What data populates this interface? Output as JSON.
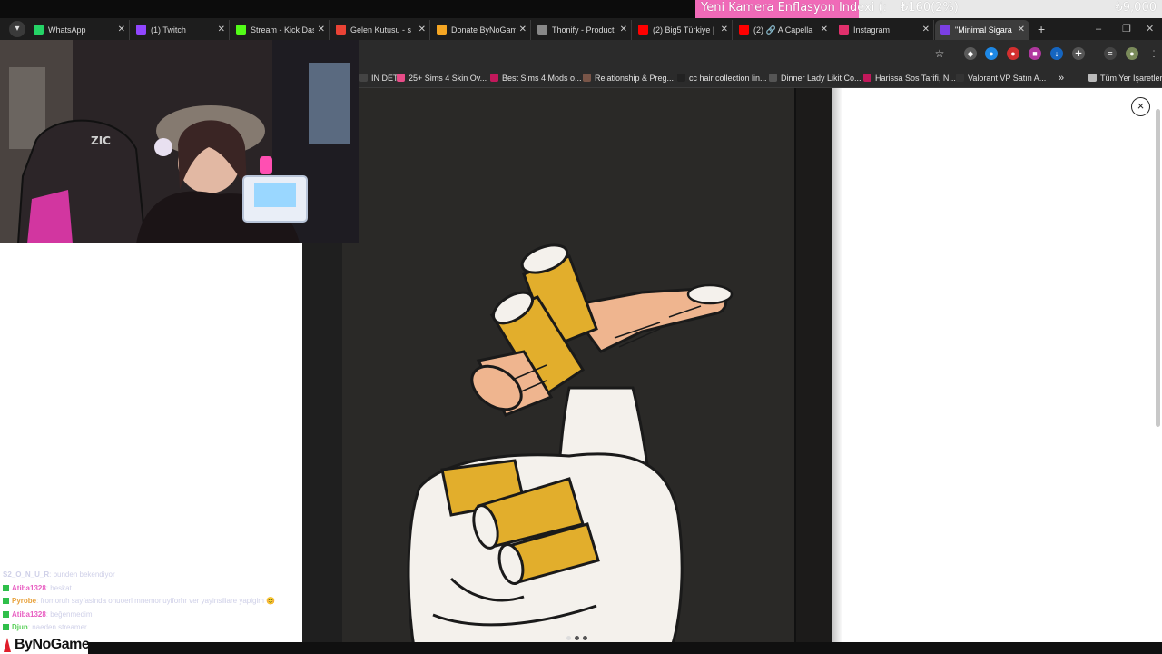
{
  "donation_goal": {
    "title": "Yeni Kamera Enflasyon Indexi (:",
    "current": "₺160(2%)",
    "target": "₺9,000",
    "progress_fraction": 0.35,
    "fill_color": "#f06ab8"
  },
  "tabs": [
    {
      "label": "WhatsApp",
      "icon": "whatsapp-icon",
      "color": "#25d366",
      "active": false
    },
    {
      "label": "(1) Twitch",
      "icon": "twitch-icon",
      "color": "#9146ff",
      "active": false
    },
    {
      "label": "Stream - Kick Das",
      "icon": "kick-icon",
      "color": "#53fc18",
      "active": false
    },
    {
      "label": "Gelen Kutusu - s",
      "icon": "gmail-icon",
      "color": "#ea4335",
      "active": false
    },
    {
      "label": "Donate ByNoGam",
      "icon": "donate-icon",
      "color": "#f5a623",
      "active": false
    },
    {
      "label": "Thonify - Product",
      "icon": "globe-icon",
      "color": "#888888",
      "active": false
    },
    {
      "label": "(2) Big5 Türkiye |",
      "icon": "youtube-icon",
      "color": "#ff0000",
      "active": false
    },
    {
      "label": "(2) 🔗 A Capella",
      "icon": "youtube-icon",
      "color": "#ff0000",
      "active": false
    },
    {
      "label": "Instagram",
      "icon": "instagram-icon",
      "color": "#e1306c",
      "active": false
    },
    {
      "label": "\"Minimal Sigara (",
      "icon": "site-icon",
      "color": "#7b3fe4",
      "active": true
    }
  ],
  "bookmarks": [
    {
      "label": "IN DET...",
      "color": "#444444"
    },
    {
      "label": "25+ Sims 4 Skin Ov...",
      "color": "#e84c88"
    },
    {
      "label": "Best Sims 4 Mods o...",
      "color": "#c2185b"
    },
    {
      "label": "Relationship & Preg...",
      "color": "#795548"
    },
    {
      "label": "cc hair collection lin...",
      "color": "#222222"
    },
    {
      "label": "Dinner Lady Likit Co...",
      "color": "#555555"
    },
    {
      "label": "Harissa Sos Tarifi, N...",
      "color": "#c2185b"
    },
    {
      "label": "Valorant VP Satın A...",
      "color": "#333333"
    },
    {
      "label": "Tüm Yer İşaretleri",
      "color": "#bbbbbb"
    }
  ],
  "more_bookmarks": "»",
  "viewer": {
    "close_label": "×",
    "slide_count": 3,
    "active_slide": 1
  },
  "chat": [
    {
      "user": "S2_O_N_U_R",
      "message": ": bunden bekendiyor",
      "color": "#cfd0e8",
      "badge": false
    },
    {
      "user": "Atiba1328",
      "message": ": heskat",
      "color": "#e85cc1",
      "badge": true
    },
    {
      "user": "Pyrobe",
      "message": ": fromoruh sayfasinda onuoerl mnemonuyiforhr ver yayinsiliare yapigim 😊",
      "color": "#e8a23c",
      "badge": true
    },
    {
      "user": "Atiba1328",
      "message": ": beğenmedim",
      "color": "#e85cc1",
      "badge": true
    },
    {
      "user": "Djun",
      "message": ": naeden streamer",
      "color": "#59d059",
      "badge": true
    }
  ],
  "branding": {
    "name": "ByNoGame"
  }
}
